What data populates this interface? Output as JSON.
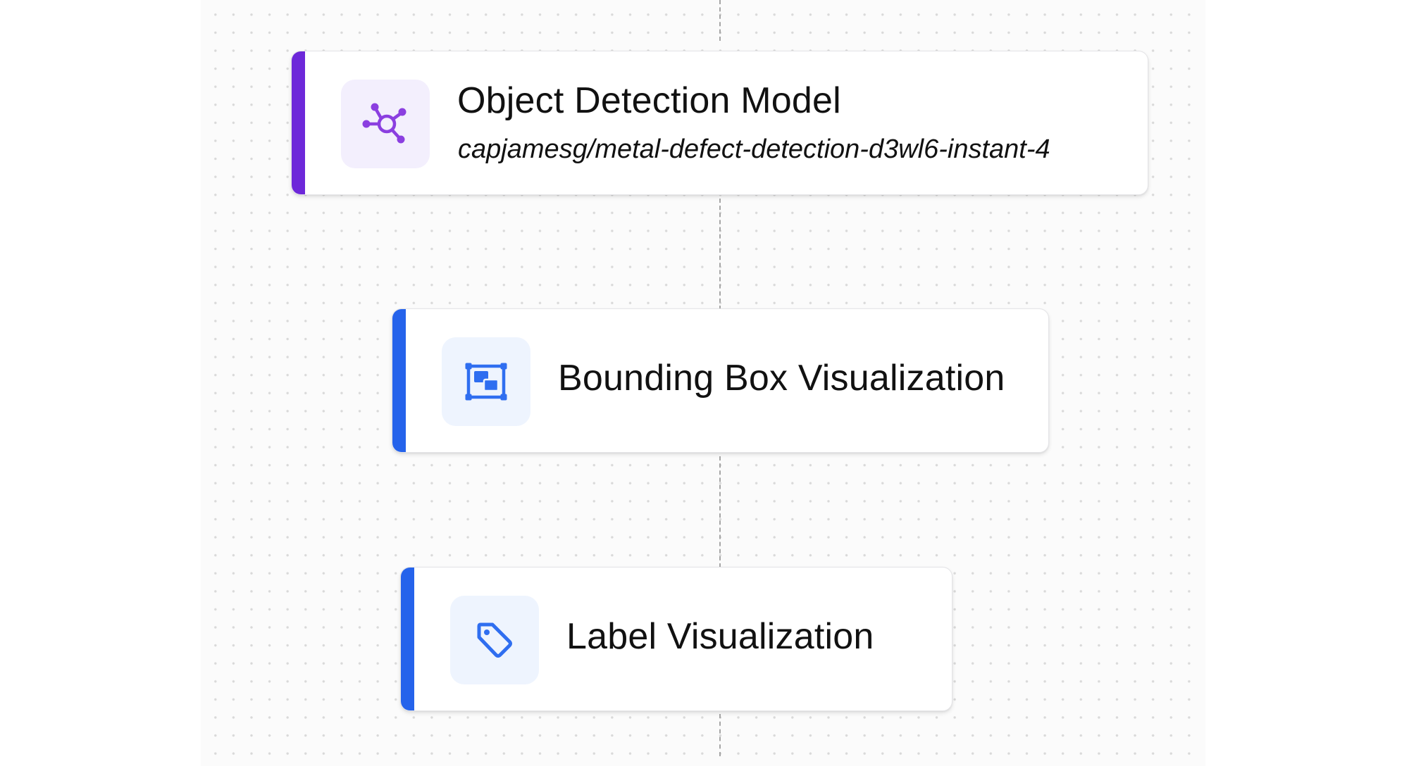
{
  "colors": {
    "model_accent": "#6d28d9",
    "model_icon": "#8b3fe0",
    "model_tile": "#f3effd",
    "viz_accent": "#2563eb",
    "viz_icon": "#2f6ef0",
    "viz_tile": "#eef4fe"
  },
  "nodes": [
    {
      "id": "object-detection-model",
      "title": "Object Detection Model",
      "subtitle": "capjamesg/metal-defect-detection-d3wl6-instant-4",
      "icon": "network-graph-icon",
      "accent": "purple"
    },
    {
      "id": "bounding-box-visualization",
      "title": "Bounding Box Visualization",
      "icon": "bounding-box-icon",
      "accent": "blue"
    },
    {
      "id": "label-visualization",
      "title": "Label Visualization",
      "icon": "tag-icon",
      "accent": "blue"
    }
  ]
}
